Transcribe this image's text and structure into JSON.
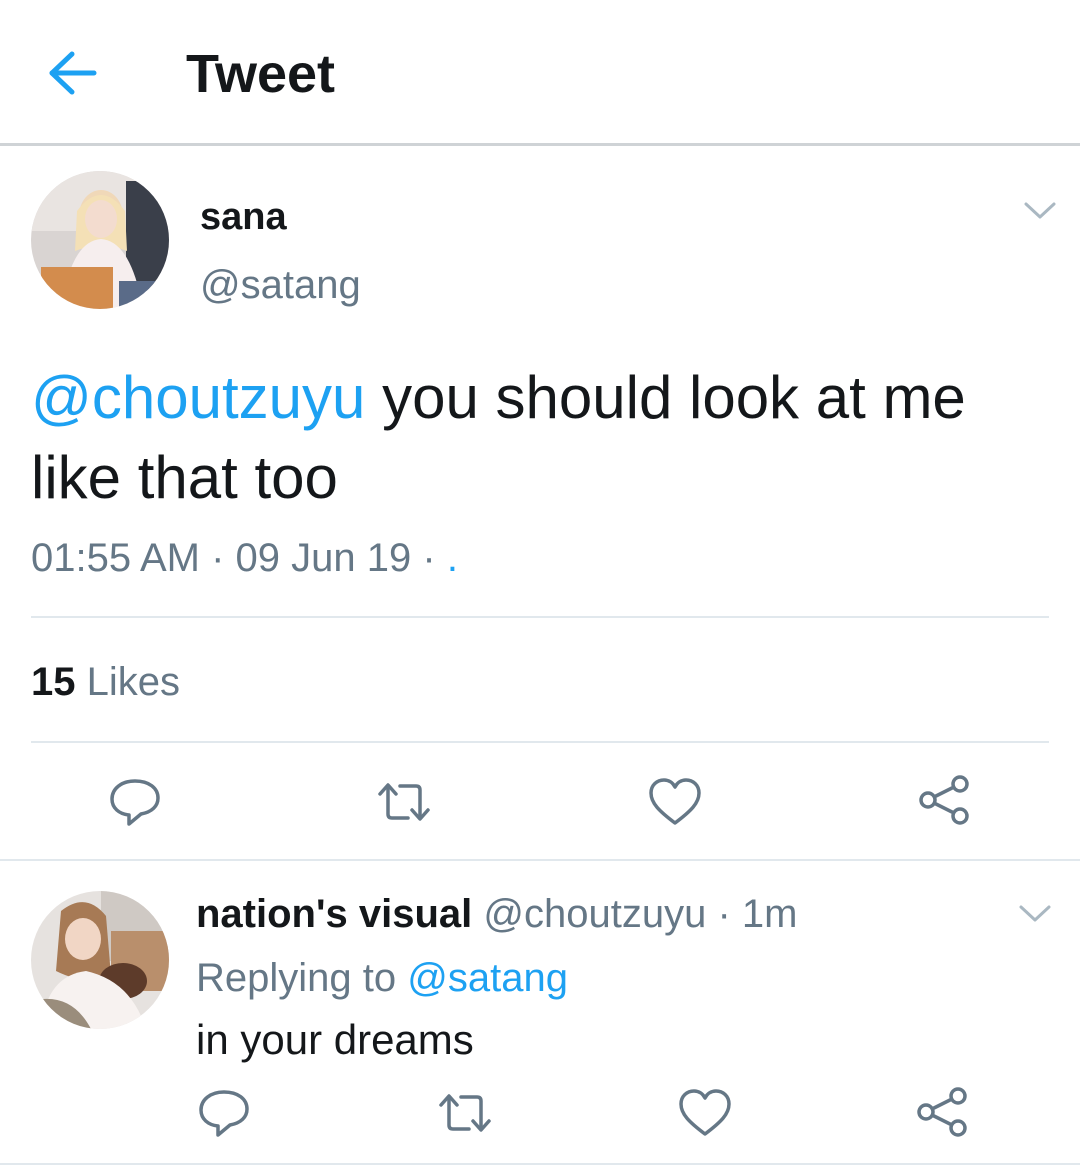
{
  "header": {
    "title": "Tweet"
  },
  "tweet": {
    "author_name": "sana",
    "author_handle": "@satang",
    "mention": "@choutzuyu",
    "text": " you should look at me like that too",
    "timestamp": "01:55 AM · 09 Jun 19 · ",
    "timestamp_dot": ".",
    "likes_count": "15",
    "likes_label": "Likes"
  },
  "reply": {
    "author_name": "nation's visual",
    "meta": "@choutzuyu · 1m",
    "replying_prefix": "Replying to ",
    "replying_to": "@satang",
    "text": "in your dreams"
  },
  "colors": {
    "accent": "#1da1f2",
    "secondary_text": "#657786",
    "primary_text": "#14171a",
    "divider": "#e1e8ed"
  },
  "icons": [
    "back-arrow-icon",
    "chevron-down-icon",
    "reply-icon",
    "retweet-icon",
    "like-icon",
    "share-icon"
  ]
}
